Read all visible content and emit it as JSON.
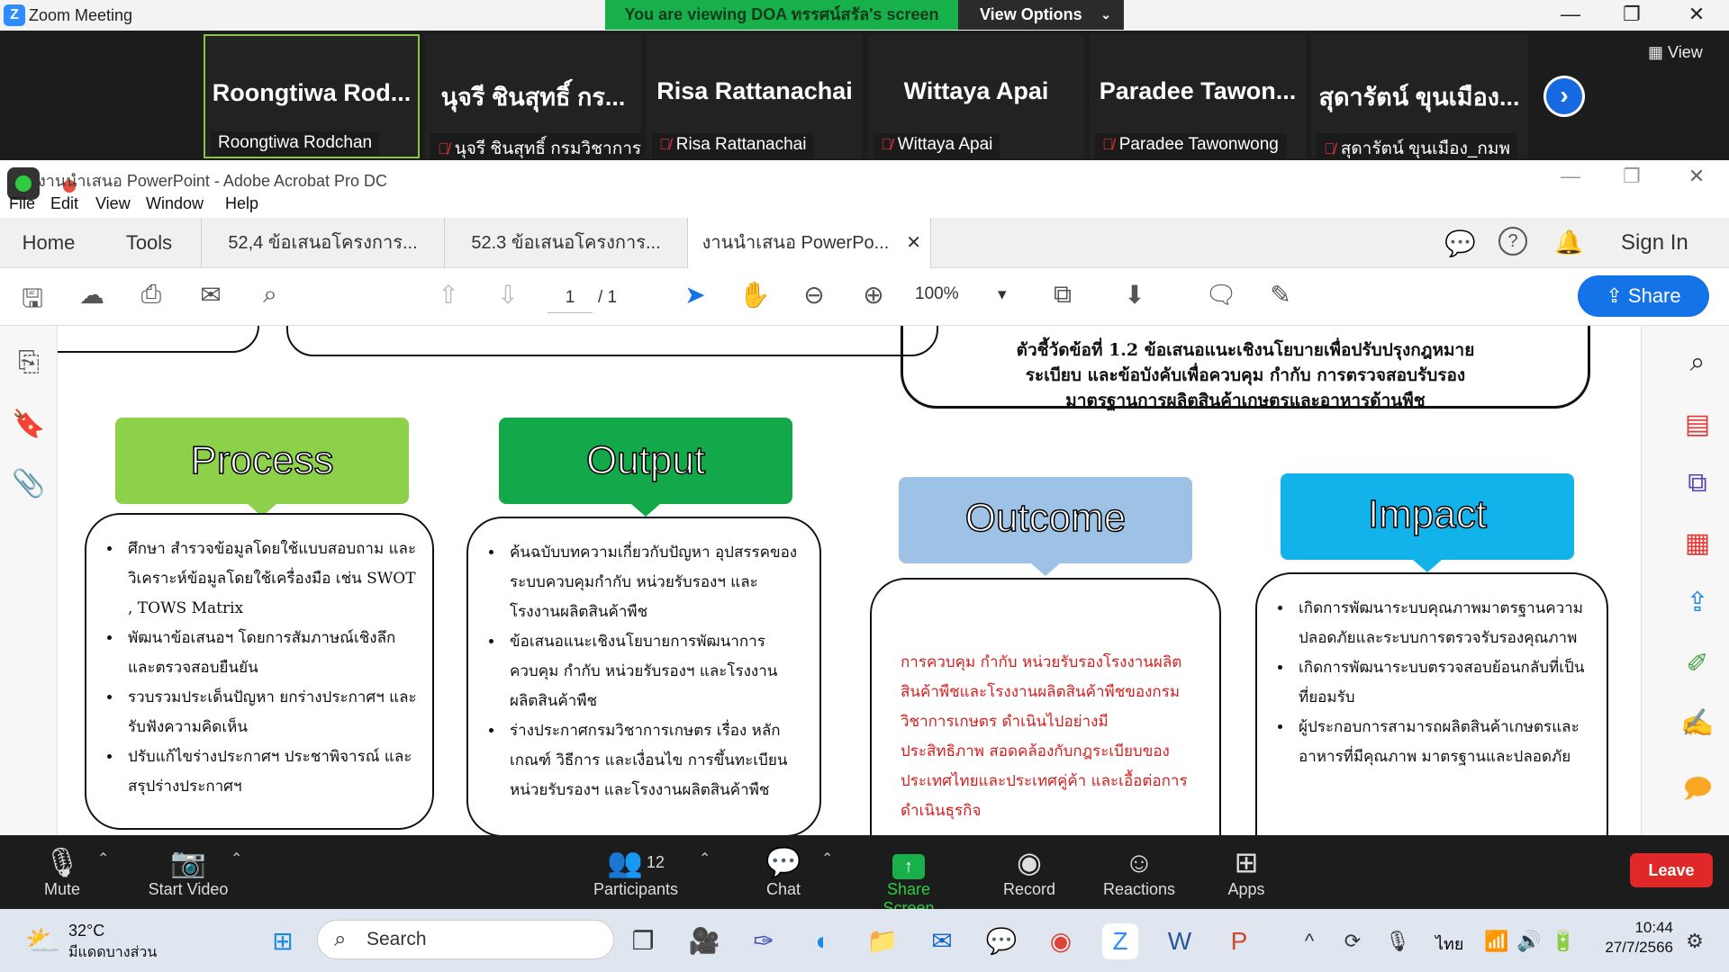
{
  "zoom": {
    "window_title": "Zoom Meeting",
    "viewing_banner": "You are viewing DOA ทรรศน์สรัล's screen",
    "view_options": "View Options",
    "view_label": "View",
    "gallery": [
      {
        "display": "Roongtiwa  Rod...",
        "name": "Roongtiwa Rodchan",
        "muted": false
      },
      {
        "display": "นุจรี ชินสุทธิ์ กร...",
        "name": "นุจรี ชินสุทธิ์ กรมวิชาการเ...",
        "muted": true
      },
      {
        "display": "Risa Rattanachai",
        "name": "Risa Rattanachai",
        "muted": true
      },
      {
        "display": "Wittaya Apai",
        "name": "Wittaya Apai",
        "muted": true
      },
      {
        "display": "Paradee  Tawon...",
        "name": "Paradee Tawonwong",
        "muted": true
      },
      {
        "display": "สุดารัตน์ ขุนเมือง...",
        "name": "สุดารัตน์ ขุนเมือง_กมพ",
        "muted": true
      }
    ],
    "controls": {
      "mute": "Mute",
      "start_video": "Start Video",
      "participants": "Participants",
      "participants_count": "12",
      "chat": "Chat",
      "share_screen": "Share Screen",
      "record": "Record",
      "reactions": "Reactions",
      "apps": "Apps",
      "leave": "Leave"
    }
  },
  "acrobat": {
    "window_title": "งานนำเสนอ PowerPoint - Adobe Acrobat Pro DC",
    "menu": [
      "File",
      "Edit",
      "View",
      "Window",
      "Help"
    ],
    "nav": {
      "home": "Home",
      "tools": "Tools"
    },
    "tabs": [
      "52,4 ข้อเสนอโครงการ...",
      "52.3 ข้อเสนอโครงการ...",
      "งานนำเสนอ PowerPo..."
    ],
    "sign_in": "Sign In",
    "page_current": "1",
    "page_total": "/ 1",
    "zoom": "100%",
    "share": "Share"
  },
  "document": {
    "indicator": "ตัวชี้วัดข้อที่ 1.2 ข้อเสนอแนะเชิงนโยบายเพื่อปรับปรุงกฎหมาย ระเบียบ และข้อบังคับเพื่อควบคุม กำกับ การตรวจสอบรับรอง มาตรฐานการผลิตสินค้าเกษตรและอาหารด้านพืช",
    "indicator_lines": [
      "ตัวชี้วัดข้อที่ 1.2 ข้อเสนอแนะเชิงนโยบายเพื่อปรับปรุงกฎหมาย",
      "ระเบียบ และข้อบังคับเพื่อควบคุม กำกับ การตรวจสอบรับรอง",
      "มาตรฐานการผลิตสินค้าเกษตรและอาหารด้านพืช"
    ],
    "process_title": "Process",
    "output_title": "Output",
    "outcome_title": "Outcome",
    "impact_title": "Impact",
    "process_items": [
      "ศึกษา สำรวจข้อมูลโดยใช้แบบสอบถาม และวิเคราะห์ข้อมูลโดยใช้เครื่องมือ เช่น SWOT , TOWS Matrix",
      "พัฒนาข้อเสนอฯ โดยการสัมภาษณ์เชิงลึก และตรวจสอบยืนยัน",
      "รวบรวมประเด็นปัญหา ยกร่างประกาศฯ และรับฟังความคิดเห็น",
      "ปรับแก้ไขร่างประกาศฯ ประชาพิจารณ์ และสรุปร่างประกาศฯ"
    ],
    "output_items": [
      "ค้นฉบับบทความเกี่ยวกับปัญหา อุปสรรคของระบบควบคุมกำกับ หน่วยรับรองฯ และโรงงานผลิตสินค้าพืช",
      "ข้อเสนอแนะเชิงนโยบายการพัฒนาการ ควบคุม กำกับ หน่วยรับรองฯ และโรงงานผลิตสินค้าพืช",
      "ร่างประกาศกรมวิชาการเกษตร เรื่อง หลักเกณฑ์ วิธีการ และเงื่อนไข การขึ้นทะเบียนหน่วยรับรองฯ และโรงงานผลิตสินค้าพืช"
    ],
    "outcome_text": "การควบคุม กำกับ หน่วยรับรองโรงงานผลิตสินค้าพืชและโรงงานผลิตสินค้าพืชของกรมวิชาการเกษตร ดำเนินไปอย่างมีประสิทธิภาพ สอดคล้องกับกฎระเบียบของประเทศไทยและประเทศคู่ค้า และเอื้อต่อการดำเนินธุรกิจ",
    "impact_items": [
      "เกิดการพัฒนาระบบคุณภาพมาตรฐานความปลอดภัยและระบบการตรวจรับรองคุณภาพ",
      "เกิดการพัฒนาระบบตรวจสอบย้อนกลับที่เป็นที่ยอมรับ",
      "ผู้ประกอบการสามารถผลิตสินค้าเกษตรและอาหารที่มีคุณภาพ มาตรฐานและปลอดภัย"
    ],
    "colors": {
      "process": "#8dd04a",
      "output": "#13a94a",
      "outcome": "#9dc2e6",
      "impact": "#12b2ea",
      "outcome_text": "#d41f1f"
    }
  },
  "taskbar": {
    "temp": "32°C",
    "weather": "มีแดดบางส่วน",
    "search": "Search",
    "lang": "ไทย",
    "time": "10:44",
    "date": "27/7/2566"
  }
}
